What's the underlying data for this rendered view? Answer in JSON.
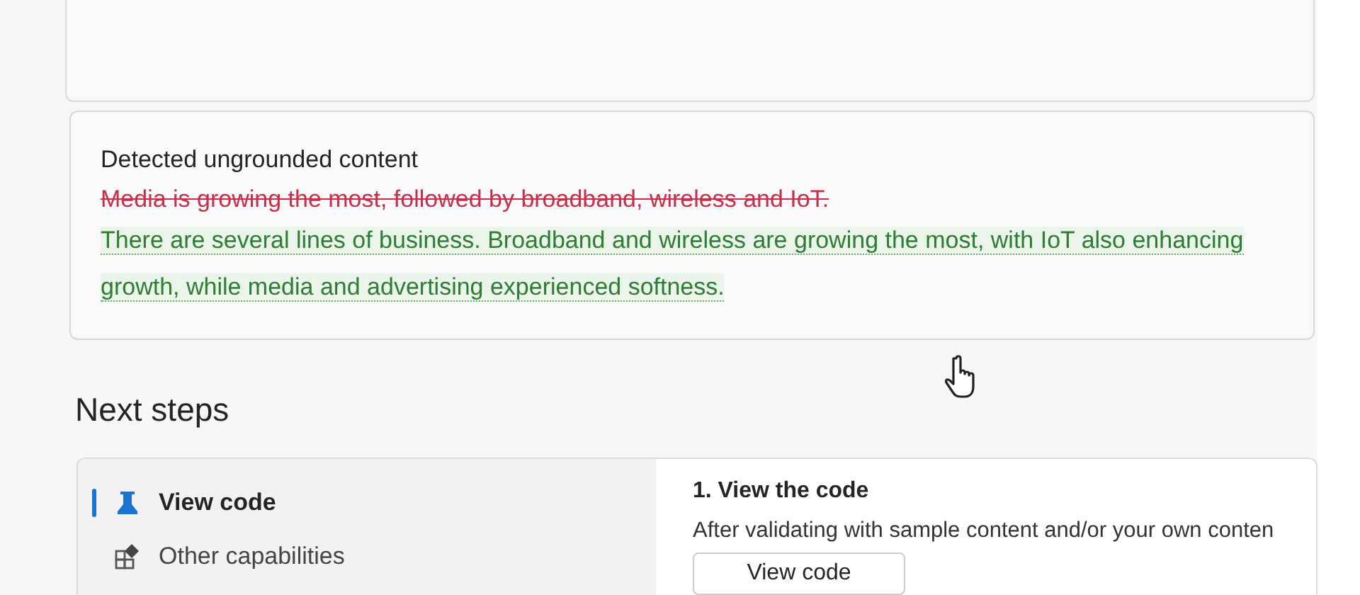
{
  "ungrounded": {
    "title": "Detected ungrounded content",
    "removed": "Media is growing the most, followed by broadband, wireless and IoT.",
    "corrected": "There are several lines of business. Broadband and wireless are growing the most, with IoT also enhancing growth, while media and advertising experienced softness."
  },
  "next_steps": {
    "heading": "Next steps",
    "nav": [
      {
        "label": "View code",
        "kind": "code",
        "selected": true
      },
      {
        "label": "Other capabilities",
        "kind": "capabilities",
        "selected": false
      }
    ],
    "step": {
      "title": "1. View the code",
      "text": "After validating with sample content and/or your own conten",
      "button": "View code"
    }
  }
}
